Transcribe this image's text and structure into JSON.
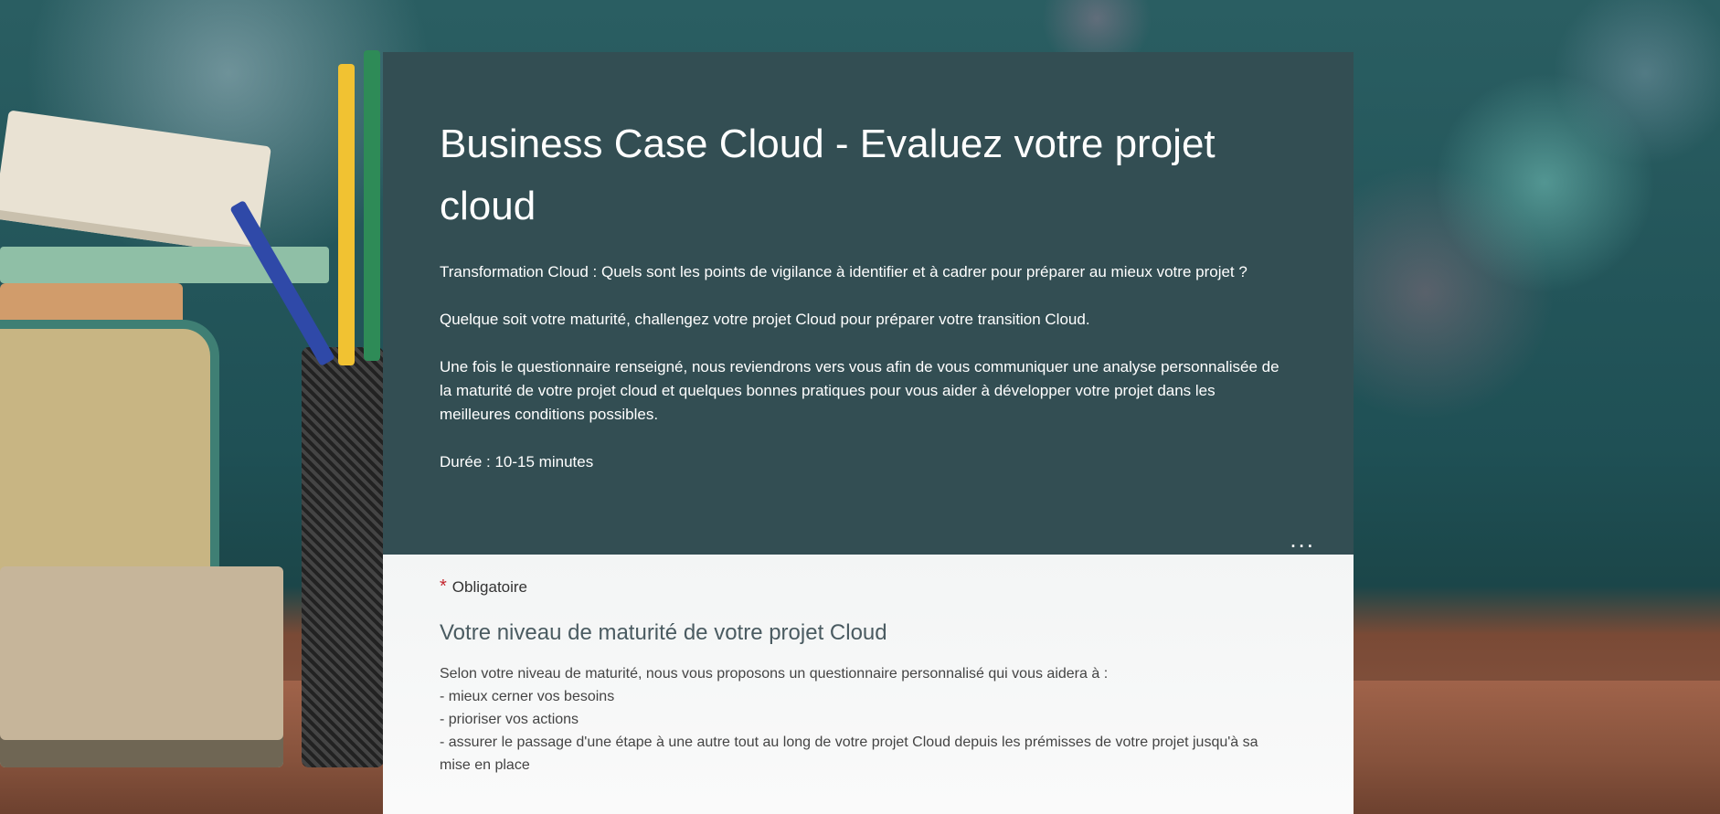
{
  "form": {
    "title": "Business Case Cloud - Evaluez votre projet cloud",
    "description": [
      "Transformation Cloud : Quels sont les points de vigilance à identifier et à cadrer pour préparer au mieux votre projet ?",
      "Quelque soit votre maturité, challengez votre projet Cloud pour préparer votre transition Cloud.",
      "Une fois le questionnaire renseigné, nous reviendrons vers vous afin de vous communiquer une analyse personnalisée de la maturité de votre projet cloud et quelques bonnes pratiques pour vous aider à développer votre projet dans les meilleures conditions possibles.",
      "Durée : 10-15 minutes"
    ],
    "more_options_label": "..."
  },
  "required": {
    "star": "*",
    "label": "Obligatoire"
  },
  "section": {
    "title": "Votre niveau de maturité de votre projet Cloud",
    "lines": [
      "Selon votre niveau de maturité, nous vous proposons un questionnaire personnalisé qui vous aidera à :",
      "- mieux cerner vos besoins",
      "- prioriser vos actions",
      "- assurer le passage d'une étape à une autre tout au long de votre projet Cloud depuis les prémisses de votre projet jusqu'à sa mise en place"
    ]
  },
  "colors": {
    "header_bg": "#334e53",
    "required_star": "#c4262e"
  },
  "background": {
    "icon": "classroom-books-pencils-image"
  }
}
